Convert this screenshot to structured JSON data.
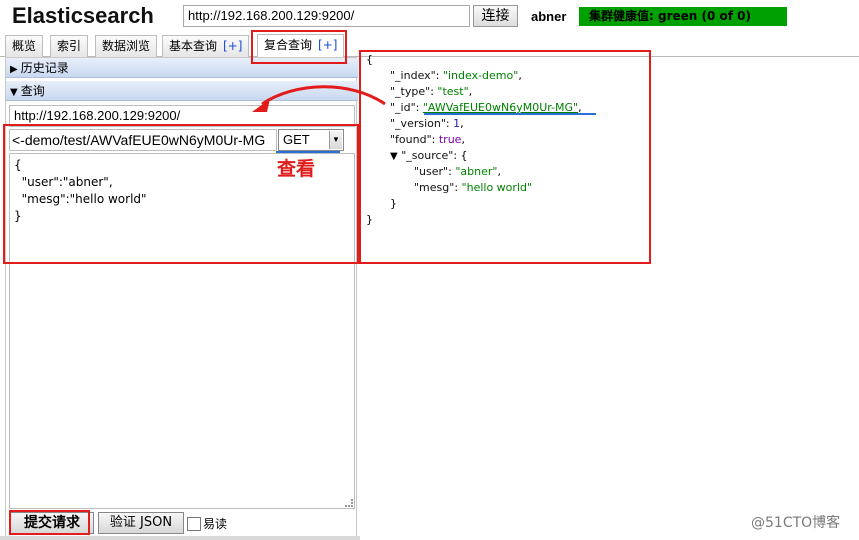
{
  "header": {
    "app_title": "Elasticsearch",
    "url": "http://192.168.200.129:9200/",
    "connect_label": "连接",
    "cluster_name": "abner",
    "health": "集群健康值: green (0 of 0)"
  },
  "tabs": [
    {
      "label": "概览",
      "plus": ""
    },
    {
      "label": "索引",
      "plus": ""
    },
    {
      "label": "数据浏览",
      "plus": ""
    },
    {
      "label": "基本查询",
      "plus": "[+]"
    },
    {
      "label": "复合查询",
      "plus": "[+]"
    }
  ],
  "query_panel": {
    "history_label": "历史记录",
    "query_label": "查询",
    "base_url": "http://192.168.200.129:9200/",
    "path": "<-demo/test/AWVafEUE0wN6yM0Ur-MG",
    "method": "GET",
    "body": "{\n  \"user\":\"abner\",\n  \"mesg\":\"hello world\"\n}",
    "submit_label": "提交请求",
    "validate_label": "验证 JSON",
    "pretty_label": "易读"
  },
  "result": {
    "open_brace": "{",
    "lines": [
      {
        "key": "\"_index\"",
        "value": "\"index-demo\""
      },
      {
        "key": "\"_type\"",
        "value": "\"test\""
      },
      {
        "key": "\"_id\"",
        "value": "\"AWVafEUE0wN6yM0Ur-MG\""
      },
      {
        "key": "\"_version\"",
        "value": "1"
      },
      {
        "key": "\"found\"",
        "value": "true"
      }
    ],
    "source_key": "\"_source\"",
    "source_lines": [
      {
        "key": "\"user\"",
        "value": "\"abner\""
      },
      {
        "key": "\"mesg\"",
        "value": "\"hello world\""
      }
    ],
    "source_close": "}",
    "close_brace": "}"
  },
  "annotation": {
    "label": "查看"
  },
  "watermark": "@51CTO博客",
  "colors": {
    "annotation_red": "#e21b1b",
    "underline_blue": "#2b6fd6",
    "health_green": "#00a000",
    "json_string": "#008000"
  }
}
